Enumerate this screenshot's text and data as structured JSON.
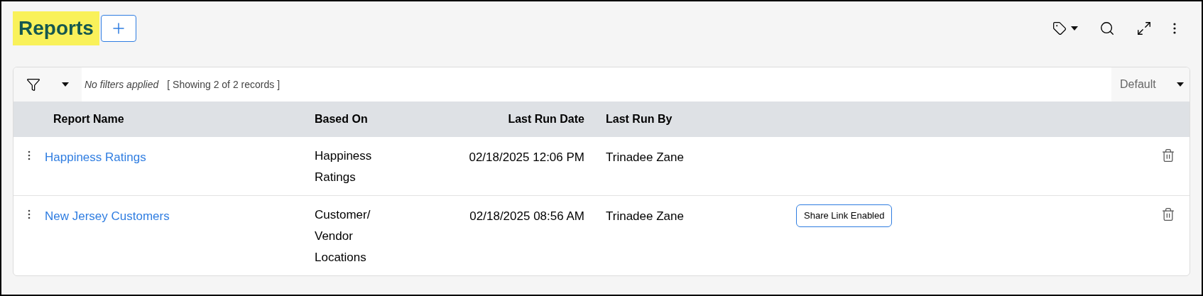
{
  "page_title": "Reports",
  "filter_bar": {
    "status": "No filters applied",
    "count": "[ Showing 2 of 2 records ]",
    "view": "Default"
  },
  "table": {
    "columns": [
      "Report Name",
      "Based On",
      "Last Run Date",
      "Last Run By"
    ],
    "rows": [
      {
        "name": "Happiness Ratings",
        "based_on": "Happiness Ratings",
        "last_run_date": "02/18/2025 12:06 PM",
        "last_run_by": "Trinadee Zane"
      },
      {
        "name": "New Jersey Customers",
        "based_on": "Customer/ Vendor Locations",
        "last_run_date": "02/18/2025 08:56 AM",
        "last_run_by": "Trinadee Zane",
        "badge": "Share Link Enabled"
      }
    ]
  }
}
